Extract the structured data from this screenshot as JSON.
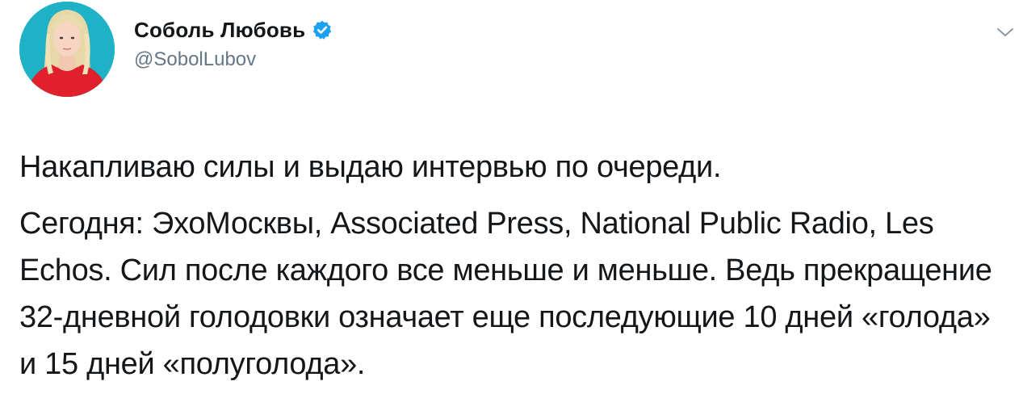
{
  "tweet": {
    "author": {
      "display_name": "Соболь Любовь",
      "handle": "@SobolLubov",
      "verified": true,
      "avatar_icon": "profile-photo"
    },
    "menu_icon": "chevron-down-icon",
    "paragraphs": [
      "Накапливаю силы и выдаю интервью по очереди.",
      "Сегодня: ЭхоМосквы, Associated Press, National Public Radio, Les Echos. Сил после каждого все меньше и меньше. Ведь прекращение 32-дневной голодовки означает еще последующие 10 дней «голода» и 15 дней «полуголода»."
    ]
  },
  "colors": {
    "text": "#14171a",
    "secondary_text": "#657786",
    "verified_blue": "#1da1f2",
    "avatar_background": "#1fb1c6",
    "avatar_sweater": "#e0202a"
  }
}
